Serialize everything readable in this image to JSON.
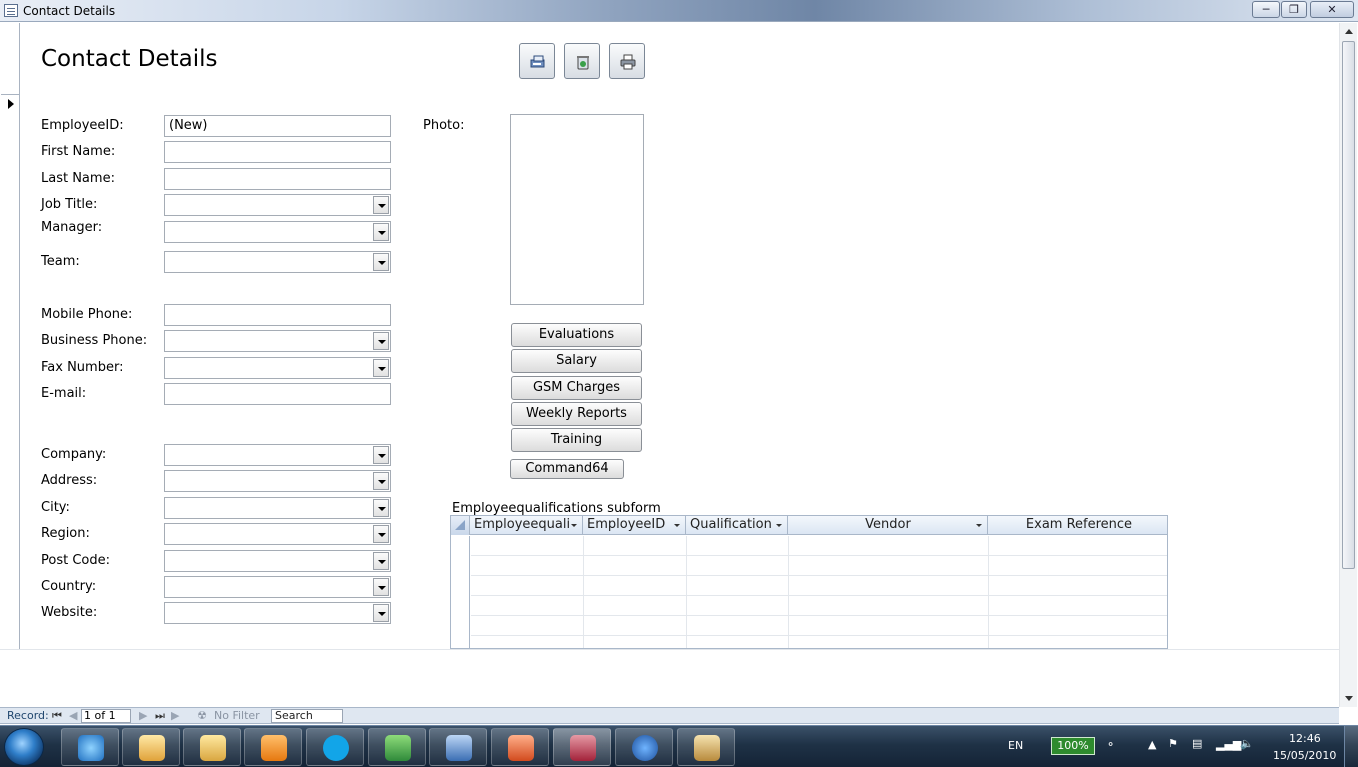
{
  "window": {
    "title": "Contact Details"
  },
  "form": {
    "title": "Contact Details",
    "fields": {
      "employee_id": {
        "label": "EmployeeID:",
        "value": "(New)"
      },
      "first_name": {
        "label": "First Name:"
      },
      "last_name": {
        "label": "Last Name:"
      },
      "job_title": {
        "label": "Job Title:"
      },
      "manager": {
        "label": "Manager:"
      },
      "team": {
        "label": "Team:"
      },
      "mobile_phone": {
        "label": "Mobile Phone:"
      },
      "business_phone": {
        "label": "Business Phone:"
      },
      "fax_number": {
        "label": "Fax Number:"
      },
      "email": {
        "label": "E-mail:"
      },
      "company": {
        "label": "Company:"
      },
      "address": {
        "label": "Address:"
      },
      "city": {
        "label": "City:"
      },
      "region": {
        "label": "Region:"
      },
      "post_code": {
        "label": "Post Code:"
      },
      "country": {
        "label": "Country:"
      },
      "website": {
        "label": "Website:"
      }
    },
    "photo_label": "Photo:",
    "buttons": {
      "evaluations": "Evaluations",
      "salary": "Salary",
      "gsm_charges": "GSM Charges",
      "weekly_reports": "Weekly Reports",
      "training": "Training",
      "command64": "Command64"
    },
    "toolbar_icons": [
      "save-record-icon",
      "delete-record-icon",
      "print-icon"
    ]
  },
  "subform": {
    "label": "Employeequalifications subform",
    "columns": [
      "Employeequali",
      "EmployeeID",
      "Qualification",
      "Vendor",
      "Exam Reference"
    ]
  },
  "navbar": {
    "record_label": "Record:",
    "record_position": "1 of 1",
    "filter_label": "No Filter",
    "search_label": "Search"
  },
  "tray": {
    "language": "EN",
    "battery": "100%",
    "time": "12:46",
    "date": "15/05/2010"
  },
  "colors": {
    "accent": "#dfe7f1",
    "taskbar": "#1f3246",
    "battery": "#2e8b2e"
  }
}
